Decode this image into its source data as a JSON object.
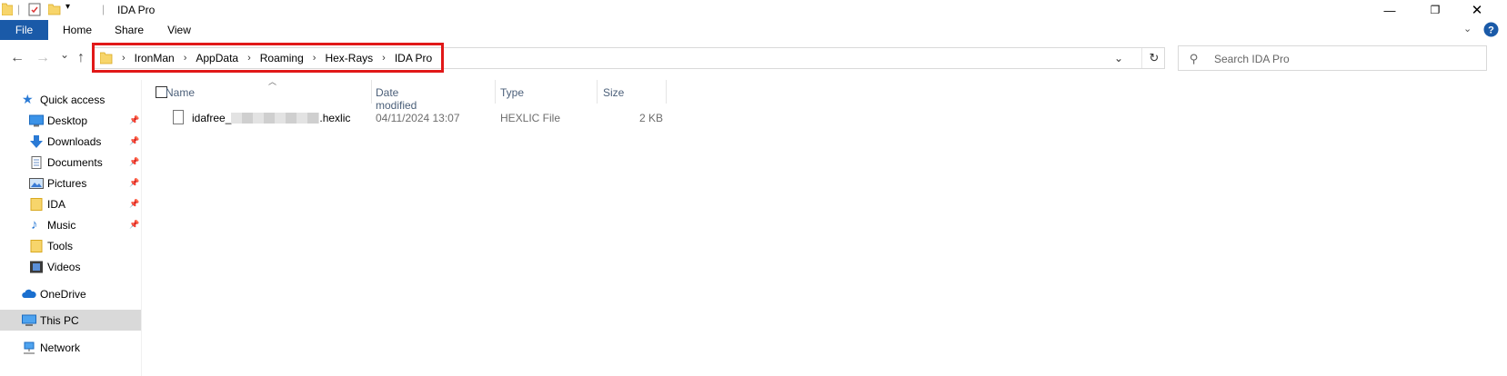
{
  "window": {
    "title": "IDA Pro",
    "controls": [
      "—",
      "❐",
      "✕"
    ]
  },
  "ribbon": {
    "tabs": [
      "File",
      "Home",
      "Share",
      "View"
    ],
    "expand_icon": "chevron-down-icon",
    "help_icon": "help-icon",
    "help_glyph": "?"
  },
  "nav": {
    "back": "←",
    "forward": "→",
    "recent": "⌄",
    "up": "↑"
  },
  "address": {
    "crumbs": [
      "IronMan",
      "AppData",
      "Roaming",
      "Hex-Rays",
      "IDA Pro"
    ],
    "separator": "›",
    "dropdown": "⌄",
    "refresh": "↻",
    "highlight_color": "#e11818"
  },
  "search": {
    "placeholder": "Search IDA Pro"
  },
  "sidebar": {
    "quick_access": "Quick access",
    "items": [
      {
        "label": "Desktop",
        "pinned": true
      },
      {
        "label": "Downloads",
        "pinned": true
      },
      {
        "label": "Documents",
        "pinned": true
      },
      {
        "label": "Pictures",
        "pinned": true
      },
      {
        "label": "IDA",
        "pinned": true
      },
      {
        "label": "Music",
        "pinned": true
      },
      {
        "label": "Tools",
        "pinned": false
      },
      {
        "label": "Videos",
        "pinned": false
      }
    ],
    "onedrive": "OneDrive",
    "this_pc": "This PC",
    "network": "Network"
  },
  "columns": [
    "Name",
    "Date modified",
    "Type",
    "Size"
  ],
  "files": [
    {
      "name_prefix": "idafree_",
      "name_suffix": ".hexlic",
      "date_modified": "04/11/2024 13:07",
      "type": "HEXLIC File",
      "size": "2 KB"
    }
  ],
  "colors": {
    "file_tab": "#1a5aa8",
    "header_text": "#4c607a",
    "selected_bg": "#d9d9d9",
    "folder_yellow": "#f7d56b"
  }
}
